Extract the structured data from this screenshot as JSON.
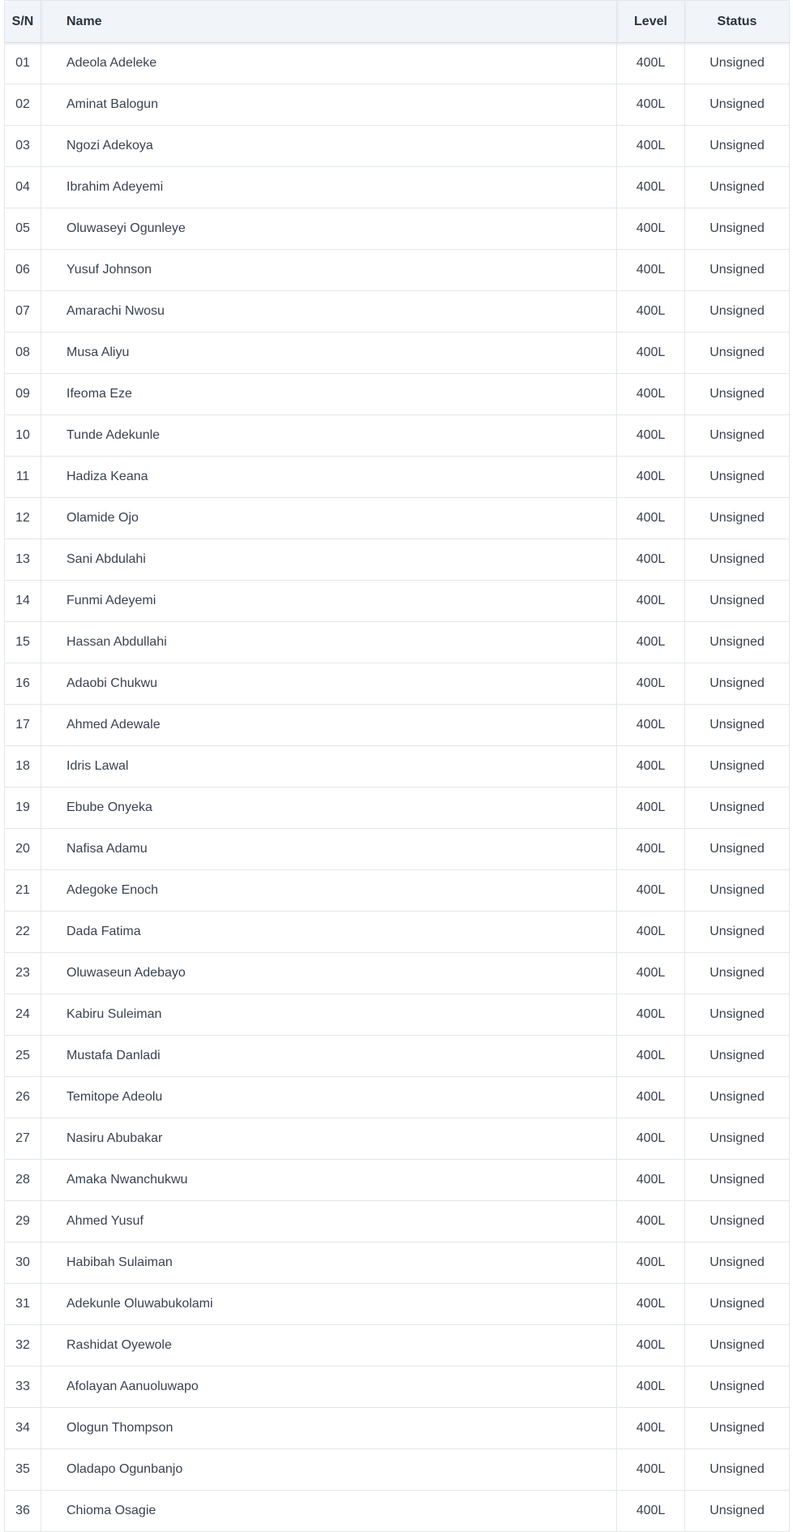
{
  "table": {
    "headers": {
      "sn": "S/N",
      "name": "Name",
      "level": "Level",
      "status": "Status"
    },
    "rows": [
      {
        "sn": "01",
        "name": "Adeola Adeleke",
        "level": "400L",
        "status": "Unsigned"
      },
      {
        "sn": "02",
        "name": "Aminat Balogun",
        "level": "400L",
        "status": "Unsigned"
      },
      {
        "sn": "03",
        "name": "Ngozi Adekoya",
        "level": "400L",
        "status": "Unsigned"
      },
      {
        "sn": "04",
        "name": "Ibrahim Adeyemi",
        "level": "400L",
        "status": "Unsigned"
      },
      {
        "sn": "05",
        "name": "Oluwaseyi Ogunleye",
        "level": "400L",
        "status": "Unsigned"
      },
      {
        "sn": "06",
        "name": "Yusuf Johnson",
        "level": "400L",
        "status": "Unsigned"
      },
      {
        "sn": "07",
        "name": "Amarachi Nwosu",
        "level": "400L",
        "status": "Unsigned"
      },
      {
        "sn": "08",
        "name": "Musa Aliyu",
        "level": "400L",
        "status": "Unsigned"
      },
      {
        "sn": "09",
        "name": "Ifeoma Eze",
        "level": "400L",
        "status": "Unsigned"
      },
      {
        "sn": "10",
        "name": "Tunde Adekunle",
        "level": "400L",
        "status": "Unsigned"
      },
      {
        "sn": "11",
        "name": "Hadiza Keana",
        "level": "400L",
        "status": "Unsigned"
      },
      {
        "sn": "12",
        "name": "Olamide Ojo",
        "level": "400L",
        "status": "Unsigned"
      },
      {
        "sn": "13",
        "name": "Sani Abdulahi",
        "level": "400L",
        "status": "Unsigned"
      },
      {
        "sn": "14",
        "name": "Funmi Adeyemi",
        "level": "400L",
        "status": "Unsigned"
      },
      {
        "sn": "15",
        "name": "Hassan Abdullahi",
        "level": "400L",
        "status": "Unsigned"
      },
      {
        "sn": "16",
        "name": "Adaobi Chukwu",
        "level": "400L",
        "status": "Unsigned"
      },
      {
        "sn": "17",
        "name": "Ahmed Adewale",
        "level": "400L",
        "status": "Unsigned"
      },
      {
        "sn": "18",
        "name": "Idris Lawal",
        "level": "400L",
        "status": "Unsigned"
      },
      {
        "sn": "19",
        "name": "Ebube Onyeka",
        "level": "400L",
        "status": "Unsigned"
      },
      {
        "sn": "20",
        "name": "Nafisa Adamu",
        "level": "400L",
        "status": "Unsigned"
      },
      {
        "sn": "21",
        "name": "Adegoke Enoch",
        "level": "400L",
        "status": "Unsigned"
      },
      {
        "sn": "22",
        "name": "Dada Fatima",
        "level": "400L",
        "status": "Unsigned"
      },
      {
        "sn": "23",
        "name": "Oluwaseun Adebayo",
        "level": "400L",
        "status": "Unsigned"
      },
      {
        "sn": "24",
        "name": "Kabiru Suleiman",
        "level": "400L",
        "status": "Unsigned"
      },
      {
        "sn": "25",
        "name": "Mustafa Danladi",
        "level": "400L",
        "status": "Unsigned"
      },
      {
        "sn": "26",
        "name": "Temitope Adeolu",
        "level": "400L",
        "status": "Unsigned"
      },
      {
        "sn": "27",
        "name": "Nasiru Abubakar",
        "level": "400L",
        "status": "Unsigned"
      },
      {
        "sn": "28",
        "name": "Amaka Nwanchukwu",
        "level": "400L",
        "status": "Unsigned"
      },
      {
        "sn": "29",
        "name": "Ahmed Yusuf",
        "level": "400L",
        "status": "Unsigned"
      },
      {
        "sn": "30",
        "name": "Habibah Sulaiman",
        "level": "400L",
        "status": "Unsigned"
      },
      {
        "sn": "31",
        "name": "Adekunle Oluwabukolami",
        "level": "400L",
        "status": "Unsigned"
      },
      {
        "sn": "32",
        "name": "Rashidat Oyewole",
        "level": "400L",
        "status": "Unsigned"
      },
      {
        "sn": "33",
        "name": "Afolayan Aanuoluwapo",
        "level": "400L",
        "status": "Unsigned"
      },
      {
        "sn": "34",
        "name": "Ologun Thompson",
        "level": "400L",
        "status": "Unsigned"
      },
      {
        "sn": "35",
        "name": "Oladapo Ogunbanjo",
        "level": "400L",
        "status": "Unsigned"
      },
      {
        "sn": "36",
        "name": "Chioma Osagie",
        "level": "400L",
        "status": "Unsigned"
      }
    ]
  }
}
